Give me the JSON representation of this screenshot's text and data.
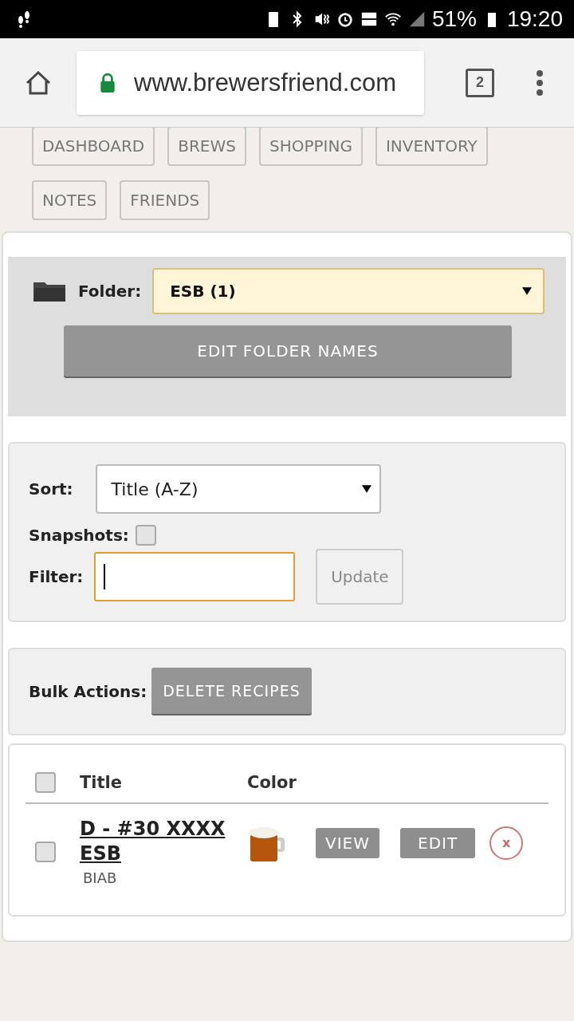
{
  "status_bar": {
    "battery": "51%",
    "time": "19:20"
  },
  "browser": {
    "url": "www.brewersfriend.com",
    "tab_count": "2"
  },
  "nav": [
    {
      "label": "DASHBOARD"
    },
    {
      "label": "BREWS"
    },
    {
      "label": "SHOPPING"
    },
    {
      "label": "INVENTORY"
    },
    {
      "label": "NOTES"
    },
    {
      "label": "FRIENDS"
    }
  ],
  "folder": {
    "label": "Folder:",
    "value": "ESB (1)",
    "button": "EDIT FOLDER NAMES"
  },
  "filters": {
    "sort_label": "Sort:",
    "sort_value": "Title (A-Z)",
    "snapshots_label": "Snapshots:",
    "snapshots_checked": false,
    "filter_label": "Filter:",
    "update_button": "Update"
  },
  "bulk": {
    "label": "Bulk Actions:",
    "button": "DELETE RECIPES"
  },
  "table": {
    "select_all_checked": false,
    "columns": [
      "Title",
      "Color"
    ],
    "rows": [
      {
        "title": "D - #30 XXXX ESB",
        "subtitle": "BIAB",
        "color": "#b5560c",
        "checked": false,
        "view": "VIEW",
        "edit": "EDIT",
        "delete": "x"
      }
    ]
  }
}
